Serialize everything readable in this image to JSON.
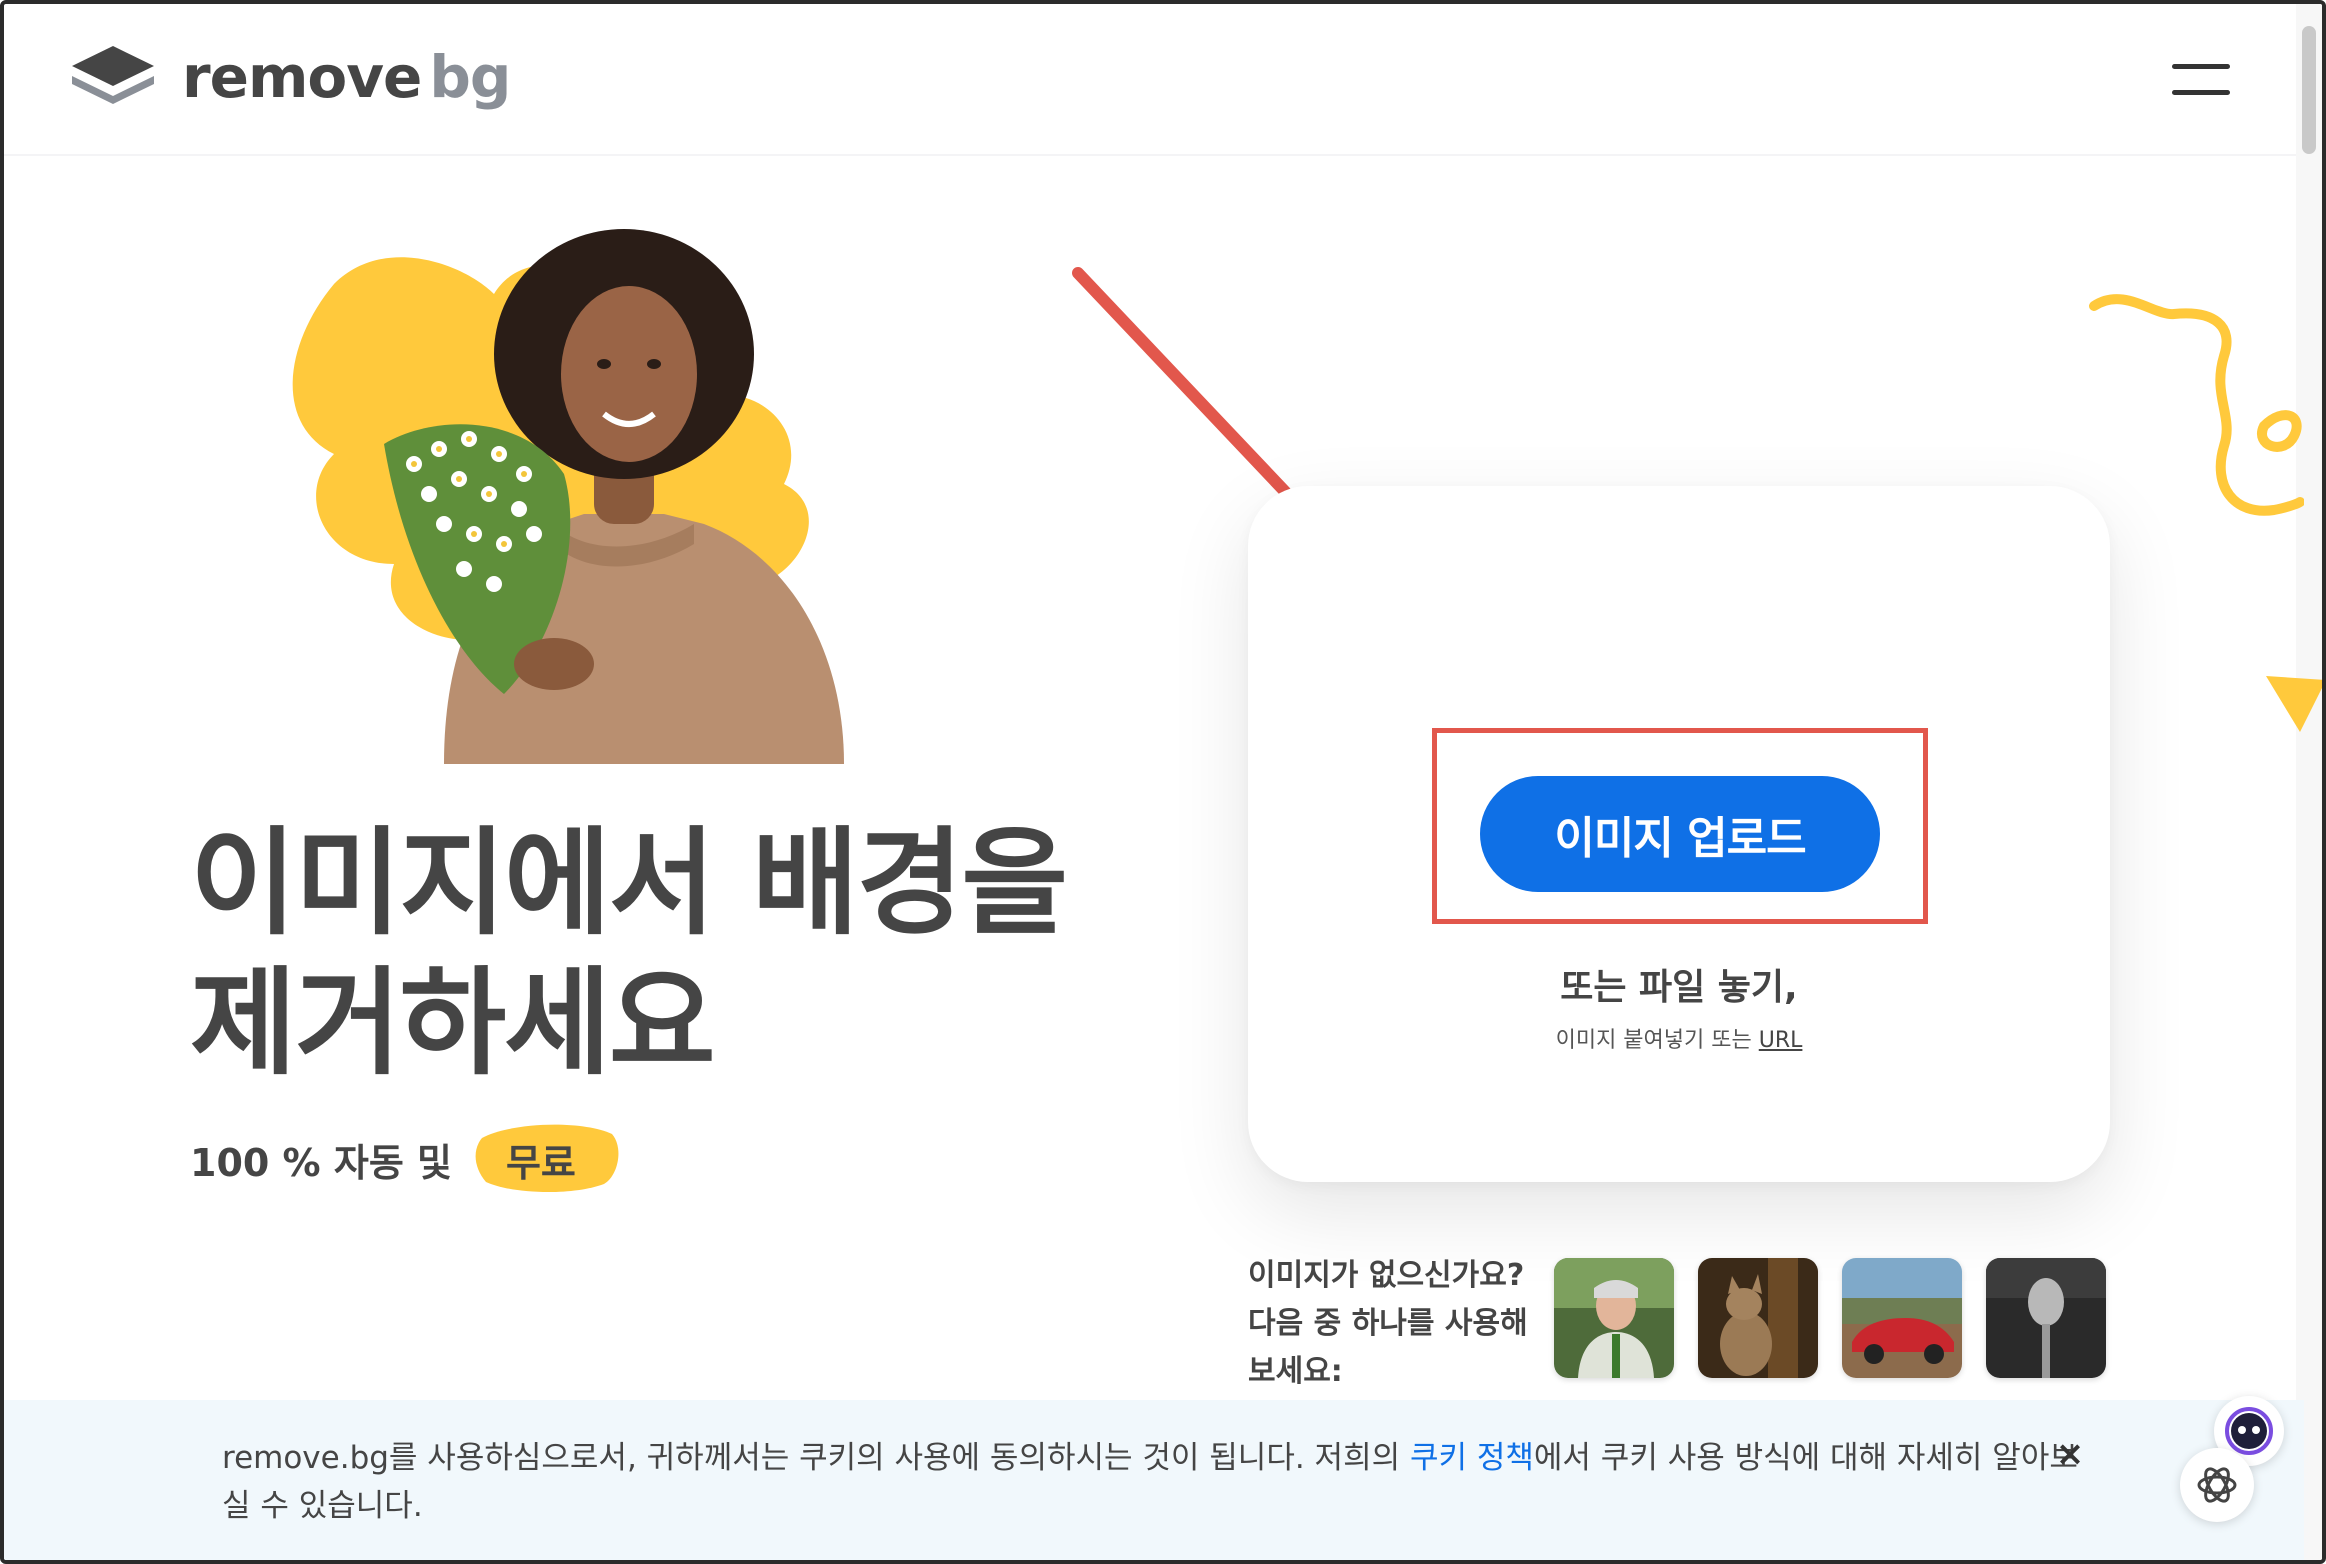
{
  "header": {
    "logo_remove": "remove",
    "logo_bg": "bg",
    "menu_icon": "hamburger-menu-icon"
  },
  "hero": {
    "headline": "이미지에서 배경을 제거하세요",
    "subtitle": "100 % 자동 및",
    "free_badge": "무료",
    "image_description_icon": "woman-with-flowers-illustration"
  },
  "upload": {
    "button_label": "이미지 업로드",
    "drop_text": "또는 파일 놓기,",
    "paste_text": "이미지 붙여넣기 또는",
    "url_link": "URL"
  },
  "samples": {
    "prompt_line1": "이미지가 없으신가요?",
    "prompt_line2": "다음 중 하나를 사용해",
    "prompt_line3": "보세요:",
    "thumbnails": [
      "person-photo",
      "cat-photo",
      "red-car-photo",
      "microphone-photo"
    ]
  },
  "cookie": {
    "text_before": "remove.bg를 사용하심으로서, 귀하께서는 쿠키의 사용에 동의하시는 것이 됩니다. 저희의 ",
    "policy_link": "쿠키 정책",
    "text_after": "에서 쿠키 사용 방식에 대해 자세히 알아보실 수 있습니다.",
    "close": "×"
  },
  "colors": {
    "primary_blue": "#0f70e6",
    "accent_yellow": "#ffc93c",
    "annotation_red": "#e2574c",
    "text_dark": "#454545",
    "cookie_bg": "#f1f8fc"
  }
}
